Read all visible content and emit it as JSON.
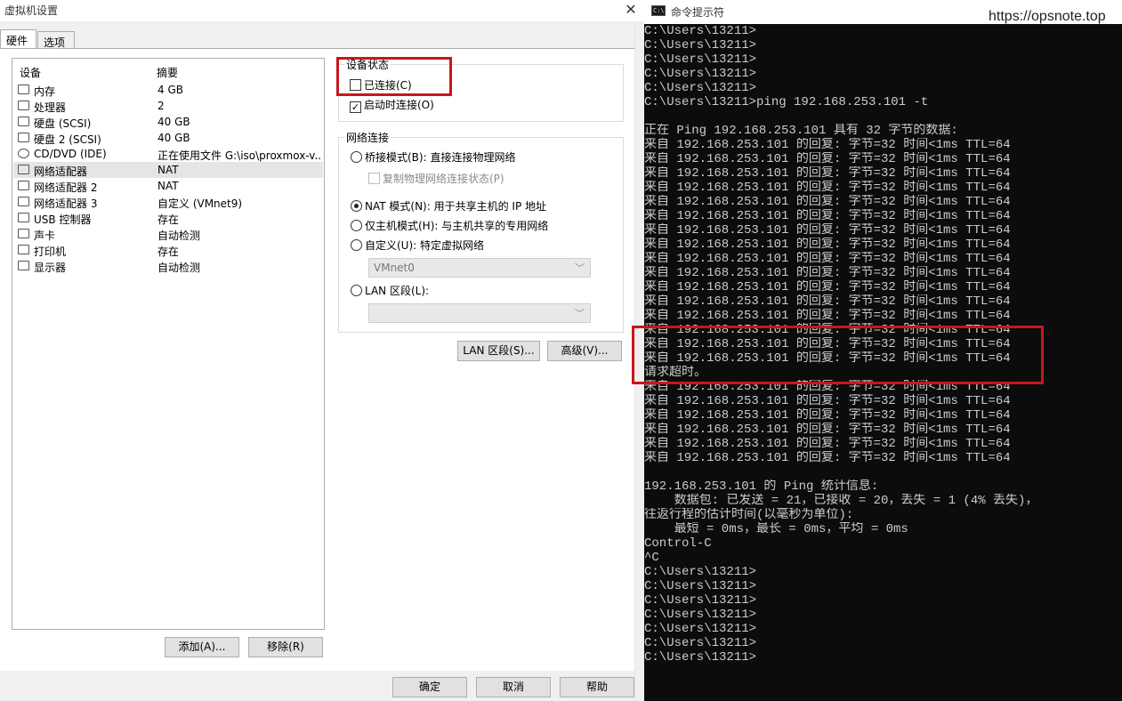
{
  "vm_dialog": {
    "title": "虚拟机设置",
    "close_glyph": "✕",
    "tabs": [
      "硬件",
      "选项"
    ],
    "columns": {
      "device": "设备",
      "summary": "摘要"
    },
    "devices": [
      {
        "name": "内存",
        "summary": "4 GB",
        "icon": "memory-icon"
      },
      {
        "name": "处理器",
        "summary": "2",
        "icon": "cpu-icon"
      },
      {
        "name": "硬盘 (SCSI)",
        "summary": "40 GB",
        "icon": "harddisk-icon"
      },
      {
        "name": "硬盘 2 (SCSI)",
        "summary": "40 GB",
        "icon": "harddisk-icon"
      },
      {
        "name": "CD/DVD (IDE)",
        "summary": "正在使用文件 G:\\iso\\proxmox-v...",
        "icon": "cd-dvd-icon"
      },
      {
        "name": "网络适配器",
        "summary": "NAT",
        "icon": "network-adapter-icon",
        "selected": true
      },
      {
        "name": "网络适配器 2",
        "summary": "NAT",
        "icon": "network-adapter-icon"
      },
      {
        "name": "网络适配器 3",
        "summary": "自定义 (VMnet9)",
        "icon": "network-adapter-icon"
      },
      {
        "name": "USB 控制器",
        "summary": "存在",
        "icon": "usb-icon"
      },
      {
        "name": "声卡",
        "summary": "自动检测",
        "icon": "sound-icon"
      },
      {
        "name": "打印机",
        "summary": "存在",
        "icon": "printer-icon"
      },
      {
        "name": "显示器",
        "summary": "自动检测",
        "icon": "display-icon"
      }
    ],
    "add_button": "添加(A)...",
    "remove_button": "移除(R)",
    "device_status": {
      "title": "设备状态",
      "connected": {
        "label": "已连接(C)",
        "checked": false
      },
      "connect_at_power_on": {
        "label": "启动时连接(O)",
        "checked": true
      }
    },
    "network_connection": {
      "title": "网络连接",
      "bridged": "桥接模式(B): 直接连接物理网络",
      "replicate_state": "复制物理网络连接状态(P)",
      "nat": "NAT 模式(N): 用于共享主机的 IP 地址",
      "host_only": "仅主机模式(H): 与主机共享的专用网络",
      "custom": "自定义(U): 特定虚拟网络",
      "custom_value": "VMnet0",
      "lan_segment": "LAN 区段(L):",
      "lan_segment_value": "",
      "selected": "nat"
    },
    "lan_segments_button": "LAN 区段(S)...",
    "advanced_button": "高级(V)...",
    "ok_button": "确定",
    "cancel_button": "取消",
    "help_button": "帮助",
    "highlight_color": "#c8161d"
  },
  "cmd": {
    "title": "命令提示符",
    "icon_text": "C:\\",
    "watermark": "https://opsnote.top",
    "lines": [
      "C:\\Users\\13211>",
      "C:\\Users\\13211>",
      "C:\\Users\\13211>",
      "C:\\Users\\13211>",
      "C:\\Users\\13211>",
      "C:\\Users\\13211>ping 192.168.253.101 -t",
      "",
      "正在 Ping 192.168.253.101 具有 32 字节的数据:",
      "来自 192.168.253.101 的回复: 字节=32 时间<1ms TTL=64",
      "来自 192.168.253.101 的回复: 字节=32 时间<1ms TTL=64",
      "来自 192.168.253.101 的回复: 字节=32 时间<1ms TTL=64",
      "来自 192.168.253.101 的回复: 字节=32 时间<1ms TTL=64",
      "来自 192.168.253.101 的回复: 字节=32 时间<1ms TTL=64",
      "来自 192.168.253.101 的回复: 字节=32 时间<1ms TTL=64",
      "来自 192.168.253.101 的回复: 字节=32 时间<1ms TTL=64",
      "来自 192.168.253.101 的回复: 字节=32 时间<1ms TTL=64",
      "来自 192.168.253.101 的回复: 字节=32 时间<1ms TTL=64",
      "来自 192.168.253.101 的回复: 字节=32 时间<1ms TTL=64",
      "来自 192.168.253.101 的回复: 字节=32 时间<1ms TTL=64",
      "来自 192.168.253.101 的回复: 字节=32 时间<1ms TTL=64",
      "来自 192.168.253.101 的回复: 字节=32 时间<1ms TTL=64",
      "来自 192.168.253.101 的回复: 字节=32 时间<1ms TTL=64",
      "来自 192.168.253.101 的回复: 字节=32 时间<1ms TTL=64",
      "来自 192.168.253.101 的回复: 字节=32 时间<1ms TTL=64",
      "请求超时。",
      "来自 192.168.253.101 的回复: 字节=32 时间<1ms TTL=64",
      "来自 192.168.253.101 的回复: 字节=32 时间<1ms TTL=64",
      "来自 192.168.253.101 的回复: 字节=32 时间<1ms TTL=64",
      "来自 192.168.253.101 的回复: 字节=32 时间<1ms TTL=64",
      "来自 192.168.253.101 的回复: 字节=32 时间<1ms TTL=64",
      "来自 192.168.253.101 的回复: 字节=32 时间<1ms TTL=64",
      "",
      "192.168.253.101 的 Ping 统计信息:",
      "    数据包: 已发送 = 21，已接收 = 20，丢失 = 1 (4% 丢失)，",
      "往返行程的估计时间(以毫秒为单位):",
      "    最短 = 0ms，最长 = 0ms，平均 = 0ms",
      "Control-C",
      "^C",
      "C:\\Users\\13211>",
      "C:\\Users\\13211>",
      "C:\\Users\\13211>",
      "C:\\Users\\13211>",
      "C:\\Users\\13211>",
      "C:\\Users\\13211>",
      "C:\\Users\\13211>"
    ],
    "text_color": "#cccccc",
    "background": "#0c0c0c"
  }
}
